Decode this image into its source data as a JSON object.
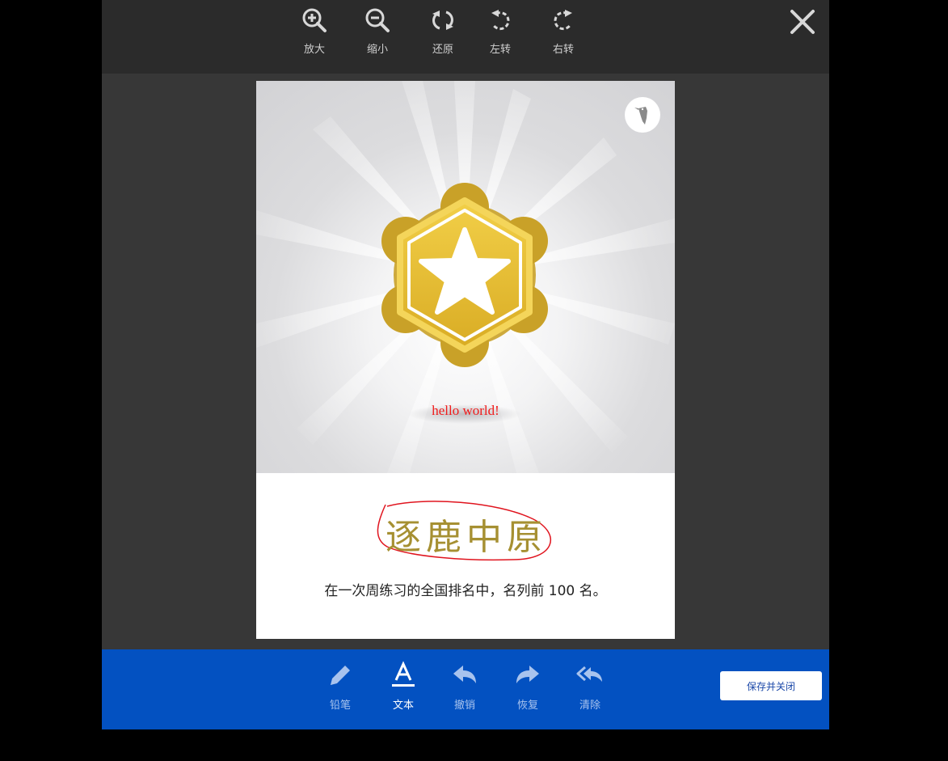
{
  "toolbar_top": {
    "zoom_in": "放大",
    "zoom_out": "缩小",
    "reset": "还原",
    "rotate_left": "左转",
    "rotate_right": "右转"
  },
  "canvas": {
    "overlay_text": "hello world!",
    "handwritten_title": "逐鹿中原",
    "description": "在一次周练习的全国排名中，名列前 100 名。"
  },
  "toolbar_bottom": {
    "pencil": "铅笔",
    "text": "文本",
    "undo": "撤销",
    "redo": "恢复",
    "clear": "清除",
    "save_close": "保存并关闭"
  },
  "colors": {
    "bottom_bar": "#0351c1",
    "overlay_text": "#f01b1b",
    "annotation_ellipse": "#e0141e",
    "title_text": "#a69032"
  }
}
